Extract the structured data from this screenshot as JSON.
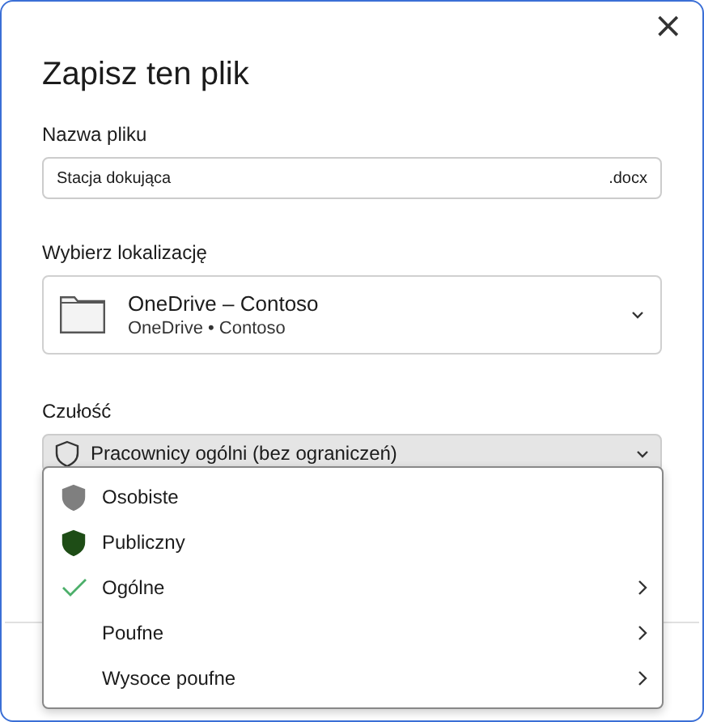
{
  "dialog": {
    "title": "Zapisz ten plik",
    "close_symbol": "×"
  },
  "file_name": {
    "label": "Nazwa pliku",
    "value": "Stacja dokująca",
    "extension": ".docx"
  },
  "location": {
    "label": "Wybierz lokalizację",
    "name": "OneDrive – Contoso",
    "path": "OneDrive • Contoso"
  },
  "sensitivity": {
    "label": "Czułość",
    "value": "Pracownicy ogólni (bez ograniczeń)",
    "expanded": true,
    "options": [
      {
        "label": "Osobiste",
        "kind": "shield",
        "color": "#7f7f7f",
        "selected": false,
        "submenu": false
      },
      {
        "label": "Publiczny",
        "kind": "shield",
        "color": "#1e4d16",
        "selected": false,
        "submenu": false
      },
      {
        "label": "Ogólne",
        "kind": "plain",
        "selected": true,
        "submenu": true
      },
      {
        "label": "Poufne",
        "kind": "plain",
        "selected": false,
        "submenu": true
      },
      {
        "label": "Wysoce poufne",
        "kind": "plain",
        "selected": false,
        "submenu": true
      }
    ]
  }
}
